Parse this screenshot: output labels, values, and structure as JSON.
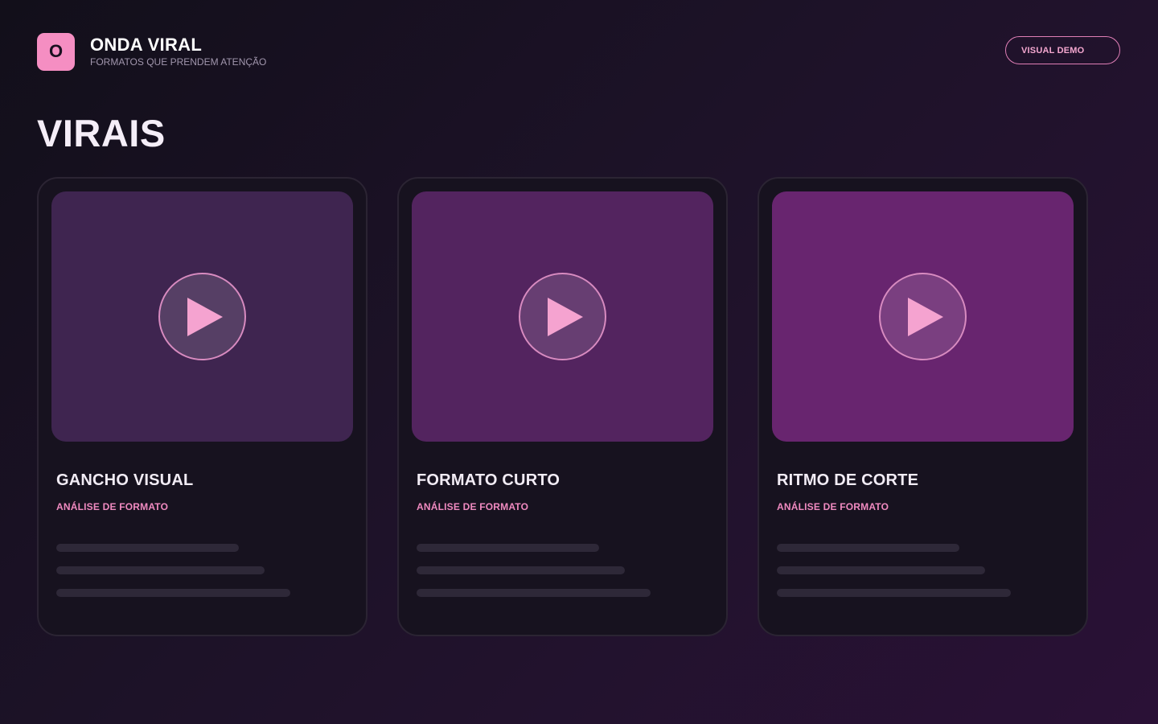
{
  "brand": {
    "logo_letter": "O",
    "name": "ONDA VIRAL",
    "tagline": "FORMATOS QUE PRENDEM ATENÇÃO"
  },
  "header": {
    "demo_button": "VISUAL DEMO"
  },
  "page": {
    "title": "VIRAIS"
  },
  "cards": [
    {
      "title": "GANCHO VISUAL",
      "subtitle": "ANÁLISE DE FORMATO",
      "thumb_color": "#3f2550"
    },
    {
      "title": "FORMATO CURTO",
      "subtitle": "ANÁLISE DE FORMATO",
      "thumb_color": "#53245f"
    },
    {
      "title": "RITMO DE CORTE",
      "subtitle": "ANÁLISE DE FORMATO",
      "thumb_color": "#68256f"
    }
  ],
  "colors": {
    "accent_pink": "#f58ec2",
    "card_bg": "#17121f",
    "play_icon": "#f5a3d0",
    "placeholder_line": "#2e2838"
  },
  "icons": {
    "play": "play-icon"
  }
}
